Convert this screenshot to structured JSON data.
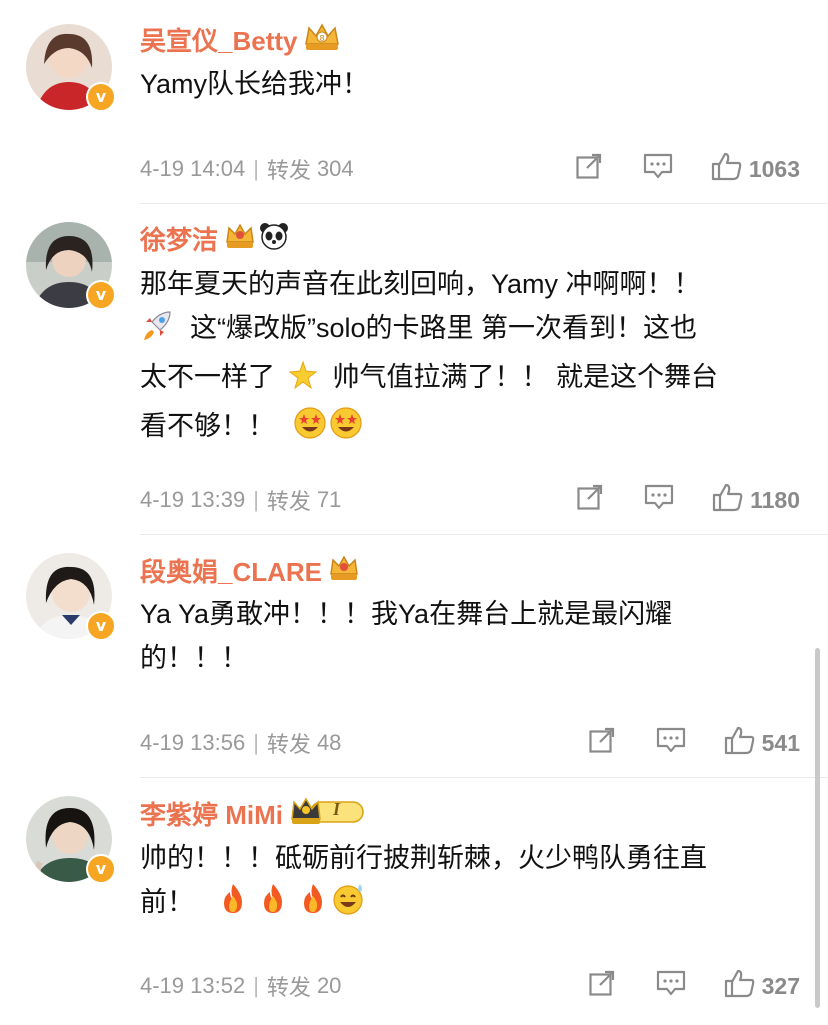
{
  "comments": [
    {
      "username": "吴宣仪_Betty",
      "text_lines": [
        "Yamy队长给我冲！"
      ],
      "date": "4-19 14:04",
      "repost_label": "转发",
      "repost_count": "304",
      "likes": "1063",
      "avatar_icon": "avatar-photo",
      "badges": [
        "crown-vip-icon"
      ]
    },
    {
      "username": "徐梦洁",
      "text_lines": [
        "那年夏天的声音在此刻回响，Yamy 冲啊啊！！",
        "这“爆改版”solo的卡路里 第一次看到！这也",
        "太不一样了",
        "帅气值拉满了！！ 就是这个舞台",
        "看不够！！"
      ],
      "date": "4-19 13:39",
      "repost_label": "转发",
      "repost_count": "71",
      "likes": "1180",
      "avatar_icon": "avatar-photo",
      "badges": [
        "crown-vip-icon",
        "panda-icon"
      ]
    },
    {
      "username": "段奥娟_CLARE",
      "text_lines": [
        "Ya Ya勇敢冲！！！我Ya在舞台上就是最闪耀",
        "的！！！"
      ],
      "date": "4-19 13:56",
      "repost_label": "转发",
      "repost_count": "48",
      "likes": "541",
      "avatar_icon": "avatar-photo",
      "badges": [
        "crown-vip-icon"
      ]
    },
    {
      "username": "李紫婷 MiMi",
      "text_lines": [
        "帅的！！！砥砺前行披荆斩棘，火少鸭队勇往直",
        "前！"
      ],
      "date": "4-19 13:52",
      "repost_label": "转发",
      "repost_count": "20",
      "likes": "327",
      "avatar_icon": "avatar-photo",
      "badges": [
        "crown-level-1-icon"
      ]
    }
  ],
  "colors": {
    "username": "#eb7350",
    "meta": "#999999",
    "verified_badge": "#f6a623",
    "body_text": "#111111"
  },
  "icons": {
    "share": "share-icon",
    "comment": "comment-icon",
    "like": "thumbs-up-icon",
    "verified": "verified-v-icon"
  },
  "level_badge_label": "I",
  "verified_label": "v"
}
